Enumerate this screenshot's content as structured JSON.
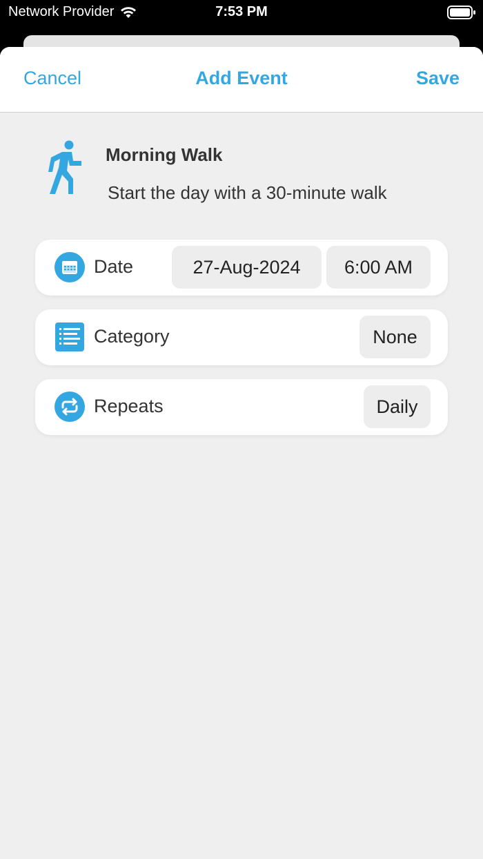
{
  "status_bar": {
    "carrier": "Network Provider",
    "time": "7:53 PM"
  },
  "nav": {
    "cancel_label": "Cancel",
    "title": "Add Event",
    "save_label": "Save"
  },
  "event": {
    "icon": "walking-person-icon",
    "title": "Morning Walk",
    "subtitle": "Start the day with a 30-minute walk"
  },
  "rows": {
    "date": {
      "icon": "calendar-icon",
      "label": "Date",
      "date_value": "27-Aug-2024",
      "time_value": "6:00 AM"
    },
    "category": {
      "icon": "list-icon",
      "label": "Category",
      "value": "None"
    },
    "repeats": {
      "icon": "repeat-icon",
      "label": "Repeats",
      "value": "Daily"
    }
  },
  "colors": {
    "accent": "#35a7e0",
    "background": "#efefef",
    "card": "#ffffff",
    "pill": "#ededed",
    "text": "#333333"
  }
}
